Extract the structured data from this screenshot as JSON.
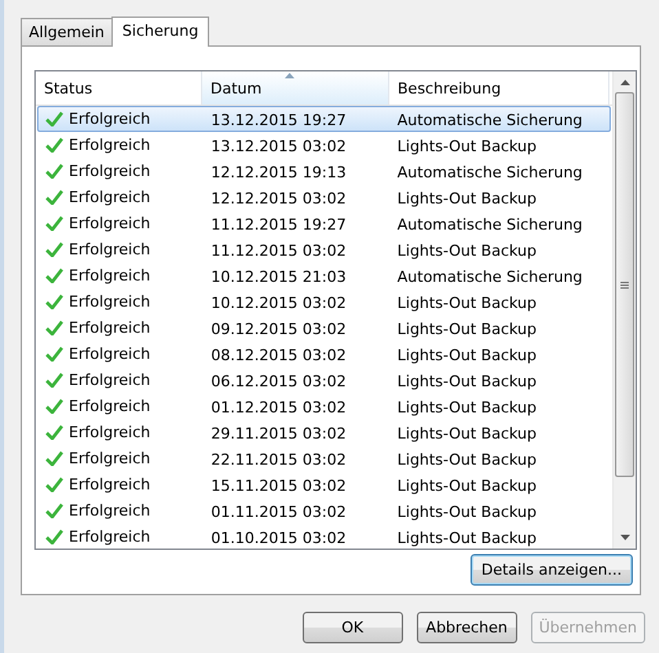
{
  "tabs": [
    {
      "label": "Allgemein",
      "selected": false
    },
    {
      "label": "Sicherung",
      "selected": true
    }
  ],
  "table": {
    "columns": [
      {
        "label": "Status",
        "sorted": false
      },
      {
        "label": "Datum",
        "sorted": true
      },
      {
        "label": "Beschreibung",
        "sorted": false
      }
    ],
    "rows": [
      {
        "status": "Erfolgreich",
        "date": "13.12.2015 19:27",
        "description": "Automatische Sicherung",
        "selected": true
      },
      {
        "status": "Erfolgreich",
        "date": "13.12.2015 03:02",
        "description": "Lights-Out Backup",
        "selected": false
      },
      {
        "status": "Erfolgreich",
        "date": "12.12.2015 19:13",
        "description": "Automatische Sicherung",
        "selected": false
      },
      {
        "status": "Erfolgreich",
        "date": "12.12.2015 03:02",
        "description": "Lights-Out Backup",
        "selected": false
      },
      {
        "status": "Erfolgreich",
        "date": "11.12.2015 19:27",
        "description": "Automatische Sicherung",
        "selected": false
      },
      {
        "status": "Erfolgreich",
        "date": "11.12.2015 03:02",
        "description": "Lights-Out Backup",
        "selected": false
      },
      {
        "status": "Erfolgreich",
        "date": "10.12.2015 21:03",
        "description": "Automatische Sicherung",
        "selected": false
      },
      {
        "status": "Erfolgreich",
        "date": "10.12.2015 03:02",
        "description": "Lights-Out Backup",
        "selected": false
      },
      {
        "status": "Erfolgreich",
        "date": "09.12.2015 03:02",
        "description": "Lights-Out Backup",
        "selected": false
      },
      {
        "status": "Erfolgreich",
        "date": "08.12.2015 03:02",
        "description": "Lights-Out Backup",
        "selected": false
      },
      {
        "status": "Erfolgreich",
        "date": "06.12.2015 03:02",
        "description": "Lights-Out Backup",
        "selected": false
      },
      {
        "status": "Erfolgreich",
        "date": "01.12.2015 03:02",
        "description": "Lights-Out Backup",
        "selected": false
      },
      {
        "status": "Erfolgreich",
        "date": "29.11.2015 03:02",
        "description": "Lights-Out Backup",
        "selected": false
      },
      {
        "status": "Erfolgreich",
        "date": "22.11.2015 03:02",
        "description": "Lights-Out Backup",
        "selected": false
      },
      {
        "status": "Erfolgreich",
        "date": "15.11.2015 03:02",
        "description": "Lights-Out Backup",
        "selected": false
      },
      {
        "status": "Erfolgreich",
        "date": "01.11.2015 03:02",
        "description": "Lights-Out Backup",
        "selected": false
      },
      {
        "status": "Erfolgreich",
        "date": "01.10.2015 03:02",
        "description": "Lights-Out Backup",
        "selected": false
      }
    ]
  },
  "details_button": {
    "label": "Details anzeigen...",
    "disabled": false
  },
  "buttons": [
    {
      "label": "OK",
      "disabled": false
    },
    {
      "label": "Abbrechen",
      "disabled": false
    },
    {
      "label": "Übernehmen",
      "disabled": true
    }
  ]
}
